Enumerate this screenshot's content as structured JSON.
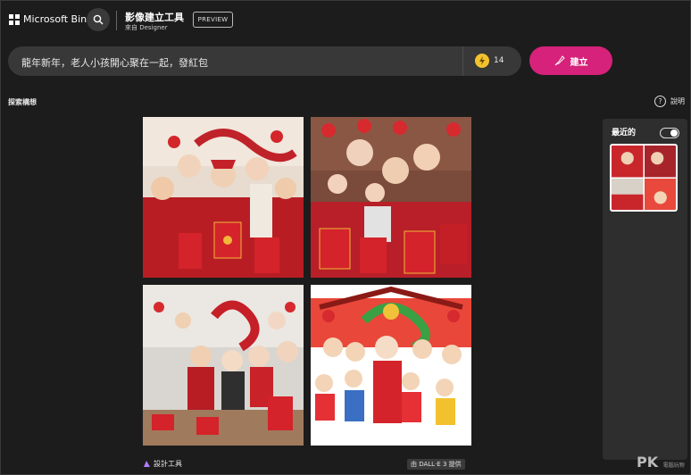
{
  "header": {
    "brand": "Microsoft Bing",
    "app_title": "影像建立工具",
    "app_subtitle": "來自 Designer",
    "preview_badge": "PREVIEW"
  },
  "prompt": {
    "value": "龍年新年，老人小孩開心聚在一起，發紅包",
    "boosts": "14",
    "create_label": "建立"
  },
  "explore_label": "探索構想",
  "help_label": "說明",
  "help_icon": "?",
  "images": [
    {
      "name": "generated-image-1"
    },
    {
      "name": "generated-image-2"
    },
    {
      "name": "generated-image-3"
    },
    {
      "name": "generated-image-4"
    }
  ],
  "footer": {
    "designer_tools": "設計工具",
    "dalle_credit": "由 DALL·E 3 提供"
  },
  "recent": {
    "title": "最近的",
    "toggle_on": true
  },
  "watermark": {
    "text": "PK",
    "sub": "電腦玩物"
  },
  "colors": {
    "background": "#1c1c1c",
    "prompt_bar": "#383838",
    "create_button": "#d6227a",
    "boost_coin": "#f2c12e",
    "panel": "#2e2e2e"
  },
  "icons": [
    "windows-logo-icon",
    "search-icon",
    "boost-coin-icon",
    "brush-icon",
    "help-icon",
    "designer-icon"
  ]
}
